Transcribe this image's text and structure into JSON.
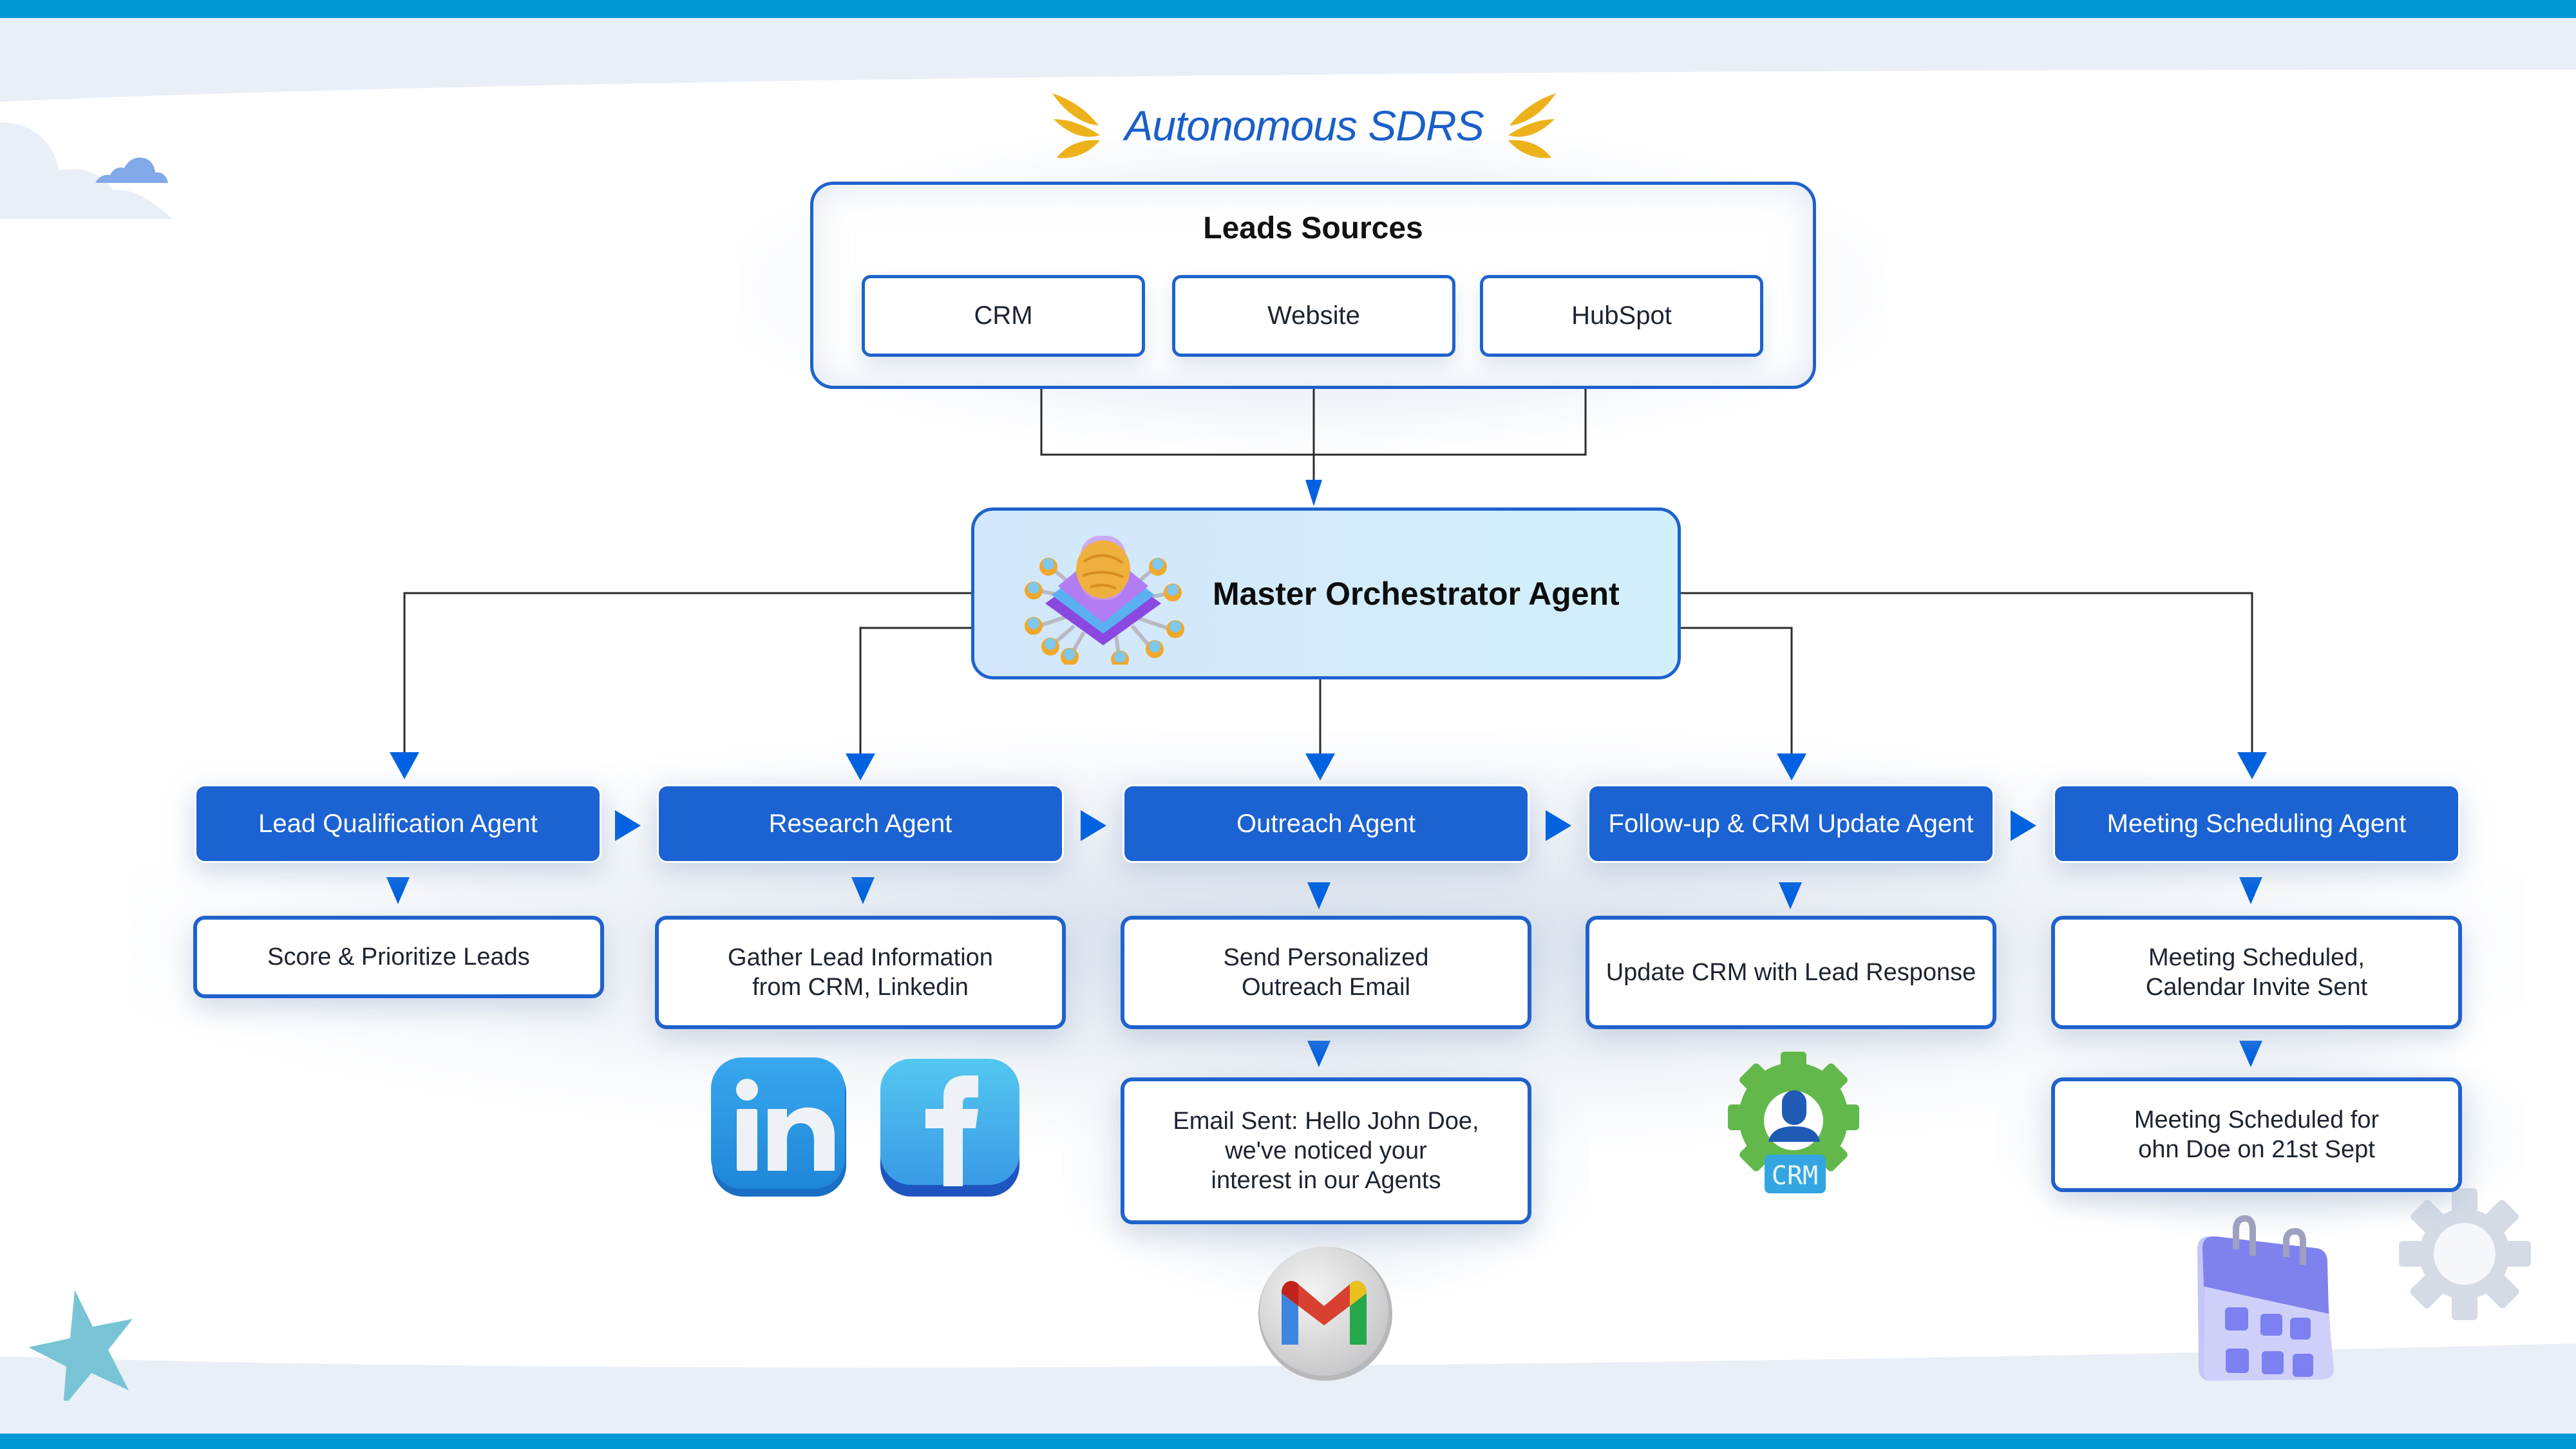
{
  "title": "Autonomous SDRS",
  "sources": {
    "heading": "Leads Sources",
    "items": [
      "CRM",
      "Website",
      "HubSpot"
    ]
  },
  "orchestrator": {
    "label": "Master Orchestrator Agent",
    "icon": "brain-chip-icon"
  },
  "agents": [
    {
      "label": "Lead Qualification Agent",
      "results": [
        "Score & Prioritize Leads"
      ],
      "icons": []
    },
    {
      "label": "Research Agent",
      "results": [
        "Gather Lead Information\nfrom CRM, Linkedin"
      ],
      "icons": [
        "linkedin-icon",
        "facebook-icon"
      ]
    },
    {
      "label": "Outreach Agent",
      "results": [
        "Send Personalized\nOutreach Email",
        "Email Sent: Hello John Doe,\nwe've noticed your\ninterest in our Agents"
      ],
      "icons": [
        "gmail-icon"
      ]
    },
    {
      "label": "Follow-up & CRM Update Agent",
      "results": [
        "Update CRM with Lead Response"
      ],
      "icons": [
        "crm-gear-icon"
      ]
    },
    {
      "label": "Meeting Scheduling Agent",
      "results": [
        "Meeting Scheduled,\nCalendar Invite Sent",
        "Meeting Scheduled for\nohn Doe on 21st Sept"
      ],
      "icons": [
        "calendar-icon"
      ]
    }
  ],
  "icon_labels": {
    "linkedin": "in",
    "facebook": "f",
    "crm": "CRM"
  },
  "colors": {
    "accent_blue": "#1b62d2",
    "border_blue": "#1f62cc",
    "arrow_blue": "#0062e0",
    "title_blue": "#1a5fc9",
    "laurel_gold": "#edb21b",
    "top_bar": "#0097d7"
  }
}
